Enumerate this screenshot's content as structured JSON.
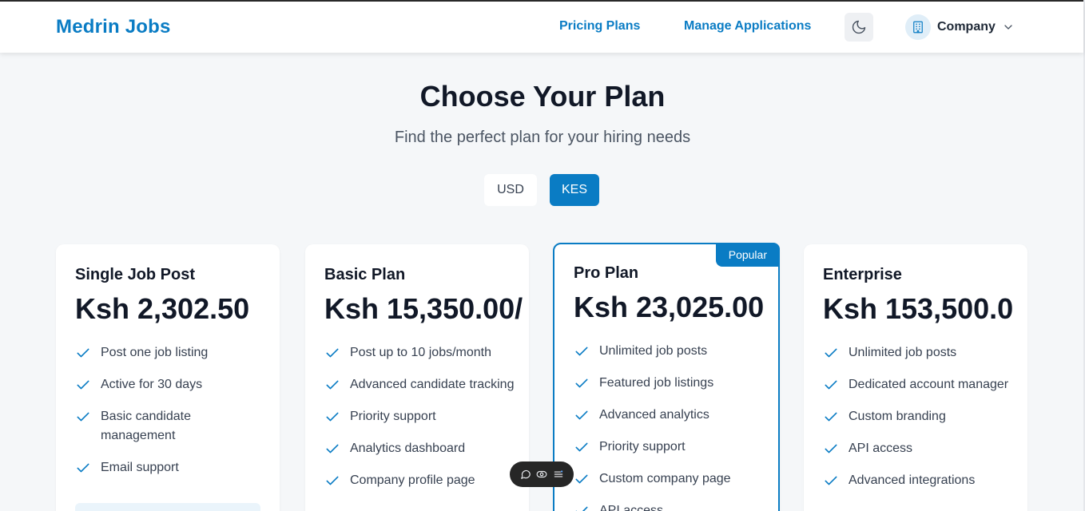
{
  "header": {
    "logo": "Medrin Jobs",
    "nav": {
      "pricing": "Pricing Plans",
      "applications": "Manage Applications"
    },
    "theme_icon": "moon-icon",
    "account": {
      "label": "Company",
      "icon": "building-icon",
      "chevron": "chevron-down-icon"
    }
  },
  "hero": {
    "title": "Choose Your Plan",
    "subtitle": "Find the perfect plan for your hiring needs"
  },
  "currency": {
    "options": [
      "USD",
      "KES"
    ],
    "selected": "KES"
  },
  "plans": [
    {
      "name": "Single Job Post",
      "price": "Ksh 2,302.50",
      "features": [
        "Post one job listing",
        "Active for 30 days",
        "Basic candidate management",
        "Email support"
      ]
    },
    {
      "name": "Basic Plan",
      "price": "Ksh 15,350.00/",
      "features": [
        "Post up to 10 jobs/month",
        "Advanced candidate tracking",
        "Priority support",
        "Analytics dashboard",
        "Company profile page"
      ]
    },
    {
      "name": "Pro Plan",
      "price": "Ksh 23,025.00",
      "badge": "Popular",
      "features": [
        "Unlimited job posts",
        "Featured job listings",
        "Advanced analytics",
        "Priority support",
        "Custom company page",
        "API access"
      ]
    },
    {
      "name": "Enterprise",
      "price": "Ksh 153,500.0",
      "features": [
        "Unlimited job posts",
        "Dedicated account manager",
        "Custom branding",
        "API access",
        "Advanced integrations"
      ]
    }
  ],
  "colors": {
    "accent": "#0a7cc4",
    "background": "#f5f7f9",
    "check": "#0a7cc4"
  }
}
